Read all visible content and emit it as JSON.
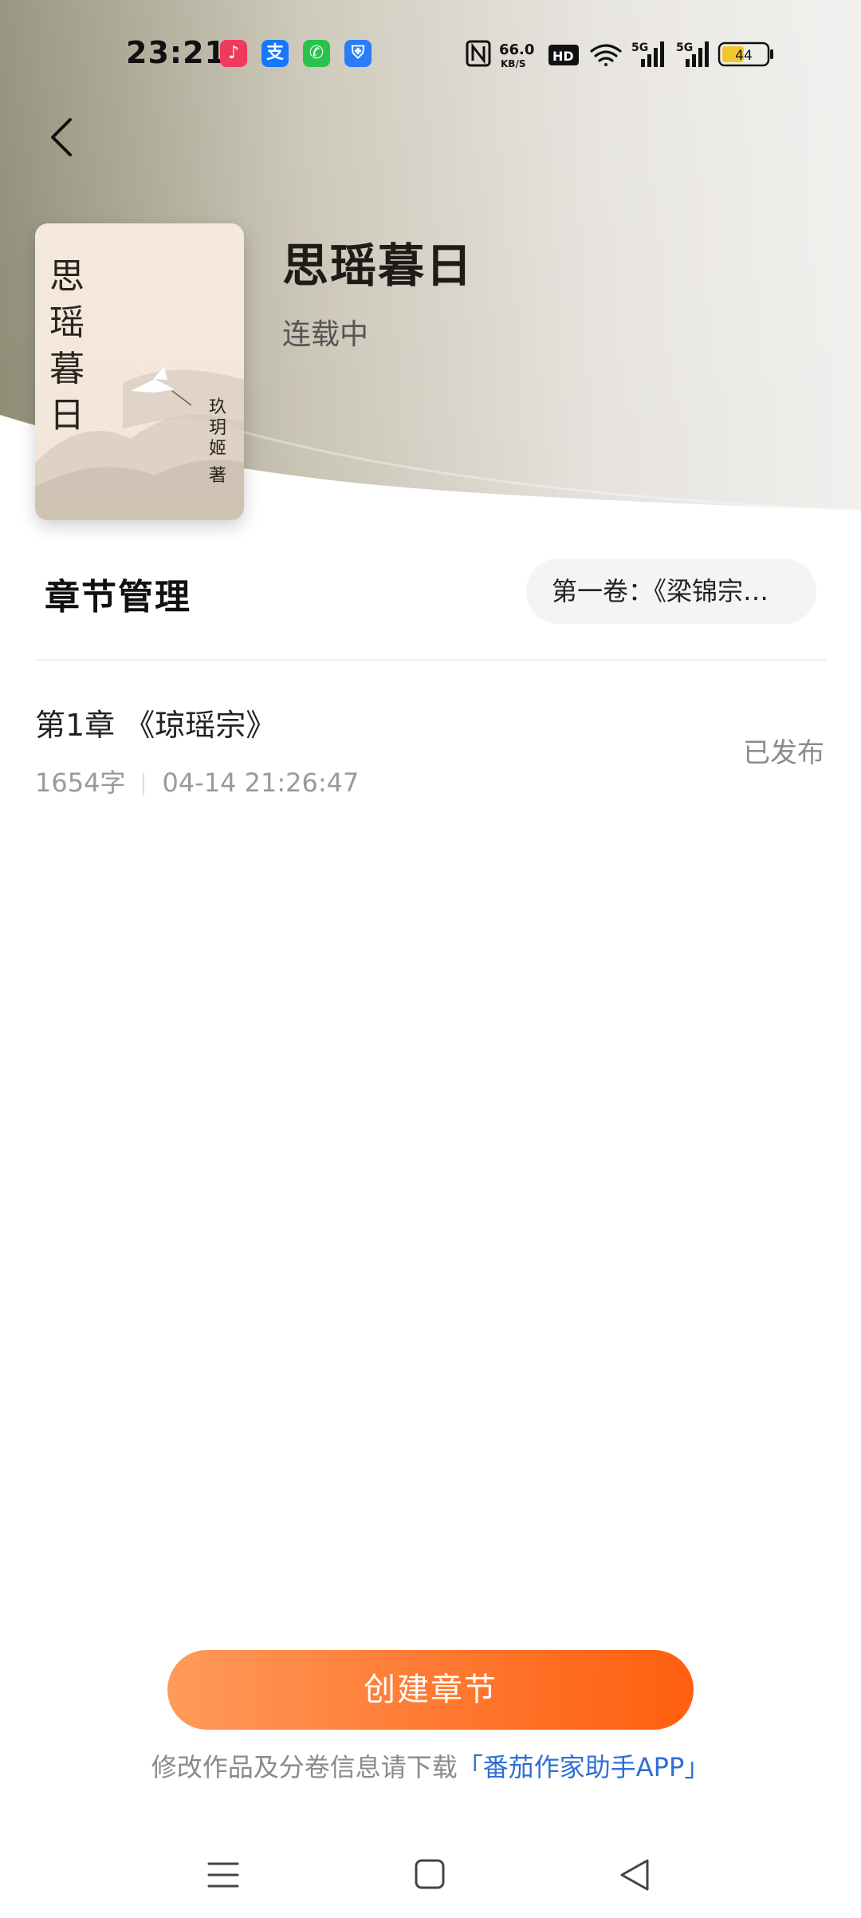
{
  "status_bar": {
    "time": "23:21",
    "net_speed_value": "66.0",
    "net_speed_unit": "KB/S",
    "battery": "44",
    "hd_label": "HD",
    "net5g_1": "5G",
    "net5g_2": "5G",
    "app_icons": [
      {
        "name": "music-app-icon",
        "color": "#ef3a5d",
        "glyph": "♪"
      },
      {
        "name": "alipay-app-icon",
        "color": "#1677ff",
        "glyph": "支"
      },
      {
        "name": "phone-app-icon",
        "color": "#2bc24c",
        "glyph": "✆"
      },
      {
        "name": "security-app-icon",
        "color": "#2a7cf7",
        "glyph": "⛨"
      }
    ]
  },
  "book": {
    "title": "思瑶暮日",
    "status": "连载中",
    "cover_title_chars": [
      "思",
      "瑶",
      "暮",
      "日"
    ],
    "cover_author_chars": [
      "玖",
      "玥",
      "姬",
      "著"
    ]
  },
  "chapters_section": {
    "title": "章节管理",
    "volume_selector": "第一卷：《梁锦宗…"
  },
  "chapters": [
    {
      "title": "第1章 《琼瑶宗》",
      "word_count": "1654字",
      "time": "04-14 21:26:47",
      "state": "已发布"
    }
  ],
  "actions": {
    "create_chapter": "创建章节",
    "hint_prefix": "修改作品及分卷信息请下载",
    "hint_link": "「番茄作家助手APP」"
  },
  "colors": {
    "accent_start": "#ff9a5a",
    "accent_end": "#ff5f0f",
    "link": "#2f6fd6"
  }
}
